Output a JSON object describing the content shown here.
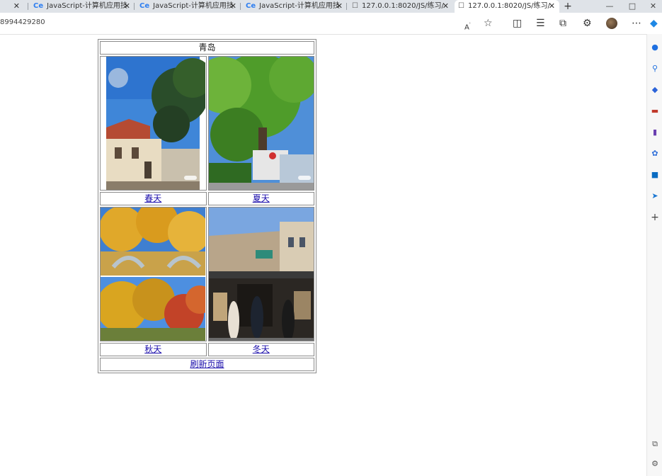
{
  "browser": {
    "tabs": [
      {
        "title": "JavaScript-计算机应用技"
      },
      {
        "title": "JavaScript-计算机应用技"
      },
      {
        "title": "JavaScript-计算机应用技"
      },
      {
        "title": "127.0.0.1:8020/JS/练习/"
      },
      {
        "title": "127.0.0.1:8020/JS/练习/"
      }
    ],
    "new_tab": "+",
    "url": "8994429280",
    "window_buttons": {
      "minimize": "—",
      "maximize": "□",
      "close": "✕"
    }
  },
  "page": {
    "title": "青岛",
    "seasons": [
      {
        "label": "春天"
      },
      {
        "label": "夏天"
      },
      {
        "label": "秋天"
      },
      {
        "label": "冬天"
      }
    ],
    "refresh_label": "刷新页面"
  }
}
